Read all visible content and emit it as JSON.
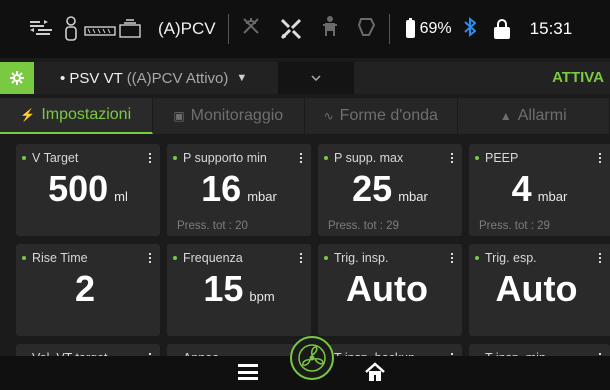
{
  "status_bar": {
    "icons": [
      "patient-circuit-icon",
      "patient-icon",
      "humidifier-icon",
      "alarm-silenced-icon",
      "tools-icon",
      "person-icon",
      "bag-icon"
    ],
    "mode": "(A)PCV",
    "battery_percent": "69%",
    "time": "15:31",
    "bluetooth_color": "#2f8ce8"
  },
  "mode_row": {
    "mode_name": "PSV VT",
    "mode_backup": "((A)PCV Attivo)",
    "status": "ATTIVA",
    "accent": "#7ac943"
  },
  "tabs": [
    {
      "label": "Impostazioni",
      "icon": "wrench-icon",
      "active": true
    },
    {
      "label": "Monitoraggio",
      "icon": "monitor-icon",
      "active": false
    },
    {
      "label": "Forme d'onda",
      "icon": "wave-icon",
      "active": false
    },
    {
      "label": "Allarmi",
      "icon": "bell-icon",
      "active": false
    }
  ],
  "tiles": [
    {
      "name": "V Target",
      "value": "500",
      "unit": "ml",
      "foot": ""
    },
    {
      "name": "P supporto min",
      "value": "16",
      "unit": "mbar",
      "foot": "Press. tot : 20"
    },
    {
      "name": "P supp. max",
      "value": "25",
      "unit": "mbar",
      "foot": "Press. tot : 29"
    },
    {
      "name": "PEEP",
      "value": "4",
      "unit": "mbar",
      "foot": "Press. tot : 29"
    },
    {
      "name": "Rise Time",
      "value": "2",
      "unit": "",
      "foot": ""
    },
    {
      "name": "Frequenza",
      "value": "15",
      "unit": "bpm",
      "foot": ""
    },
    {
      "name": "Trig. insp.",
      "value": "Auto",
      "unit": "",
      "foot": ""
    },
    {
      "name": "Trig. esp.",
      "value": "Auto",
      "unit": "",
      "foot": ""
    },
    {
      "name": "Vol. VT target",
      "value": "",
      "unit": "",
      "foot": ""
    },
    {
      "name": "Apnea",
      "value": "",
      "unit": "",
      "foot": ""
    },
    {
      "name": "T insp. backup",
      "value": "",
      "unit": "",
      "foot": ""
    },
    {
      "name": "T insp. min",
      "value": "",
      "unit": "",
      "foot": ""
    }
  ],
  "bottom_bar": {
    "icons": [
      "menu-icon",
      "fan-icon",
      "home-icon"
    ]
  }
}
